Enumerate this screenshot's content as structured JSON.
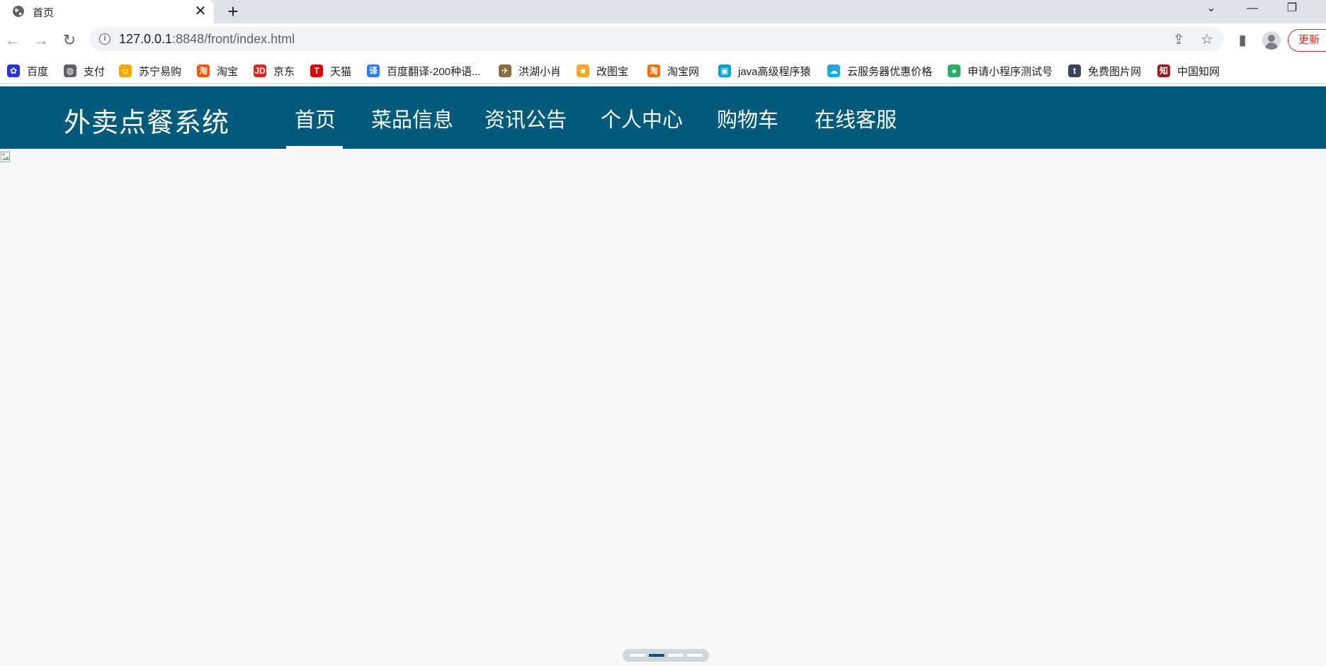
{
  "browser": {
    "tab": {
      "title": "首页",
      "close": "✕"
    },
    "new_tab": "+",
    "window_controls": {
      "menu": "⌄",
      "minimize": "—",
      "restore": "❐"
    },
    "toolbar": {
      "back": "←",
      "forward": "→",
      "reload": "↻",
      "url_host": "127.0.0.1",
      "url_rest": ":8848/front/index.html",
      "share": "⇪",
      "star": "☆",
      "side_panel": "▮",
      "update_label": "更新"
    },
    "bookmarks": [
      {
        "label": "百度",
        "icon": "baidu-icon",
        "color": "#2932e1",
        "glyph": "✿"
      },
      {
        "label": "支付",
        "icon": "globe-icon",
        "color": "#5f6368",
        "glyph": "◍"
      },
      {
        "label": "苏宁易购",
        "icon": "suning-icon",
        "color": "#f2a900",
        "glyph": "☺"
      },
      {
        "label": "淘宝",
        "icon": "taobao-icon",
        "color": "#ff5000",
        "glyph": "淘"
      },
      {
        "label": "京东",
        "icon": "jd-icon",
        "color": "#e1251b",
        "glyph": "JD"
      },
      {
        "label": "天猫",
        "icon": "tmall-icon",
        "color": "#e20000",
        "glyph": "T"
      },
      {
        "label": "百度翻译-200种语...",
        "icon": "translate-icon",
        "color": "#2b7bf5",
        "glyph": "译"
      },
      {
        "label": "洪湖小肖",
        "icon": "bird-icon",
        "color": "#8a6d3b",
        "glyph": "✈"
      },
      {
        "label": "改图宝",
        "icon": "gaitubao-icon",
        "color": "#f5a623",
        "glyph": "■"
      },
      {
        "label": "淘宝网",
        "icon": "taobao-net-icon",
        "color": "#ff6a00",
        "glyph": "淘"
      },
      {
        "label": "java高级程序猿",
        "icon": "bilibili-icon",
        "color": "#00a1d6",
        "glyph": "▣"
      },
      {
        "label": "云服务器优惠价格",
        "icon": "cloud-icon",
        "color": "#1ba9e1",
        "glyph": "☁"
      },
      {
        "label": "申请小程序测试号",
        "icon": "wechat-icon",
        "color": "#2aae67",
        "glyph": "●"
      },
      {
        "label": "免费图片网",
        "icon": "tumblr-icon",
        "color": "#36465d",
        "glyph": "t"
      },
      {
        "label": "中国知网",
        "icon": "cnki-icon",
        "color": "#9b1c1c",
        "glyph": "知"
      }
    ]
  },
  "site": {
    "title": "外卖点餐系统",
    "brand_color": "#005a7c",
    "nav": [
      {
        "label": "首页",
        "active": true
      },
      {
        "label": "菜品信息",
        "active": false
      },
      {
        "label": "资讯公告",
        "active": false
      },
      {
        "label": "个人中心",
        "active": false
      },
      {
        "label": "购物车",
        "active": false
      },
      {
        "label": "在线客服",
        "active": false
      }
    ],
    "carousel": {
      "slides": 4,
      "active_index": 1
    }
  }
}
